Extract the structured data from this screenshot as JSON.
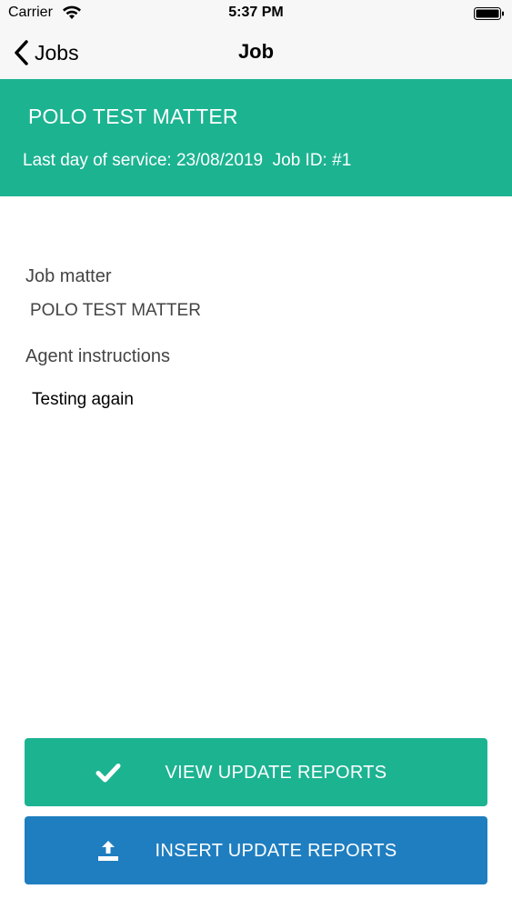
{
  "status_bar": {
    "carrier": "Carrier",
    "time": "5:37 PM",
    "icons": [
      "wifi-icon",
      "battery-icon"
    ]
  },
  "nav": {
    "back_label": "Jobs",
    "title": "Job"
  },
  "header": {
    "title": "POLO TEST MATTER",
    "last_day_label": "Last day of service:",
    "last_day_value": "23/08/2019",
    "job_id_label": "Job ID:",
    "job_id_value": "#1"
  },
  "details": {
    "job_matter_label": "Job matter",
    "job_matter_value": "POLO TEST MATTER",
    "agent_instructions_label": "Agent instructions",
    "agent_instructions_value": "Testing again"
  },
  "actions": {
    "view_label": "VIEW UPDATE REPORTS",
    "view_icon": "checkmark-icon",
    "insert_label": "INSERT UPDATE REPORTS",
    "insert_icon": "upload-icon"
  },
  "colors": {
    "accent_green": "#1cb391",
    "accent_blue": "#1f7ec0",
    "bar_background": "#f7f7f7"
  }
}
